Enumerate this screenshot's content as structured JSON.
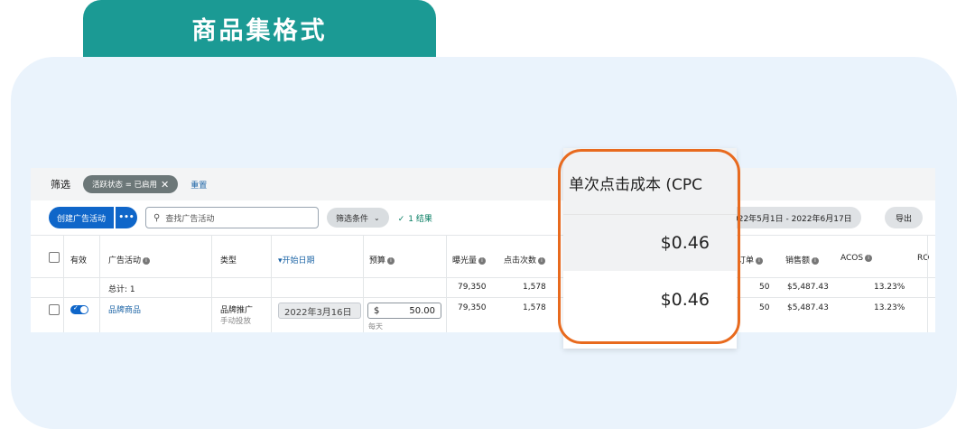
{
  "tab_title": "商品集格式",
  "toolbar": {
    "filter_label": "筛选",
    "filter_chip": "活跃状态 = 已启用",
    "chip_close": "✕",
    "reset": "重置",
    "create_button": "创建广告活动",
    "more_button": "•••",
    "search_placeholder": "查找广告活动",
    "filter_conditions": "筛选条件",
    "result_count": "1 结果",
    "date_range": "022年5月1日 - 2022年6月17日",
    "export": "导出"
  },
  "table": {
    "headers": {
      "active": "有效",
      "campaign": "广告活动",
      "type": "类型",
      "start_date": "开始日期",
      "budget": "预算",
      "impressions": "曝光量",
      "clicks": "点击次数",
      "orders": "订单",
      "sales": "销售额",
      "acos": "ACOS",
      "ro": "RO"
    },
    "total_row": {
      "label": "总计: 1",
      "impressions": "79,350",
      "clicks": "1,578",
      "orders": "50",
      "sales": "$5,487.43",
      "acos": "13.23%"
    },
    "rows": [
      {
        "campaign": "品牌商品",
        "type": "品牌推广",
        "type_sub": "手动投放",
        "start_date": "2022年3月16日",
        "budget_currency": "$",
        "budget_value": "50.00",
        "budget_period": "每天",
        "impressions": "79,350",
        "clicks": "1,578",
        "orders": "50",
        "sales": "$5,487.43",
        "acos": "13.23%"
      }
    ]
  },
  "callout": {
    "header": "单次点击成本 (CPC",
    "total_value": "$0.46",
    "row_value": "$0.46"
  },
  "colors": {
    "tab_teal": "#1b9a94",
    "panel_bg": "#eaf3fc",
    "primary_blue": "#0f66c9",
    "highlight_orange": "#e86a1e",
    "success_green": "#067d62"
  }
}
